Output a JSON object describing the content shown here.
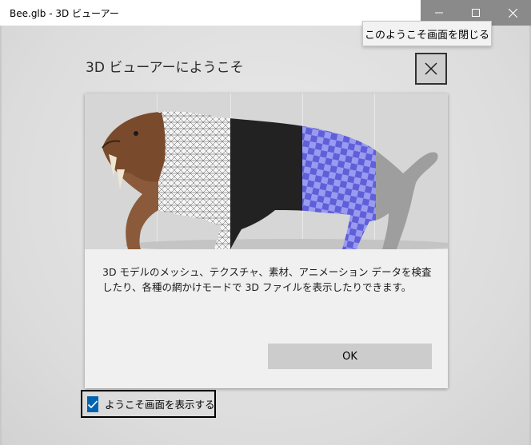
{
  "window": {
    "title": "Bee.glb - 3D ビューアー"
  },
  "tooltip": {
    "text": "このようこそ画面を閉じる"
  },
  "dialog": {
    "title": "3D ビューアーにようこそ",
    "description": "3D モデルのメッシュ、テクスチャ、素材、アニメーション データを検査したり、各種の網かけモードで 3D ファイルを表示したりできます。",
    "ok_label": "OK"
  },
  "show_welcome": {
    "label": "ようこそ画面を表示する",
    "checked": true
  },
  "colors": {
    "accent": "#0063b1",
    "titlebar_controls": "#8a8a8a",
    "button": "#cccccc"
  },
  "icons": {
    "minimize": "minimize-icon",
    "maximize": "maximize-icon",
    "close": "close-icon",
    "dialog_close": "close-icon",
    "check": "checkmark-icon"
  }
}
